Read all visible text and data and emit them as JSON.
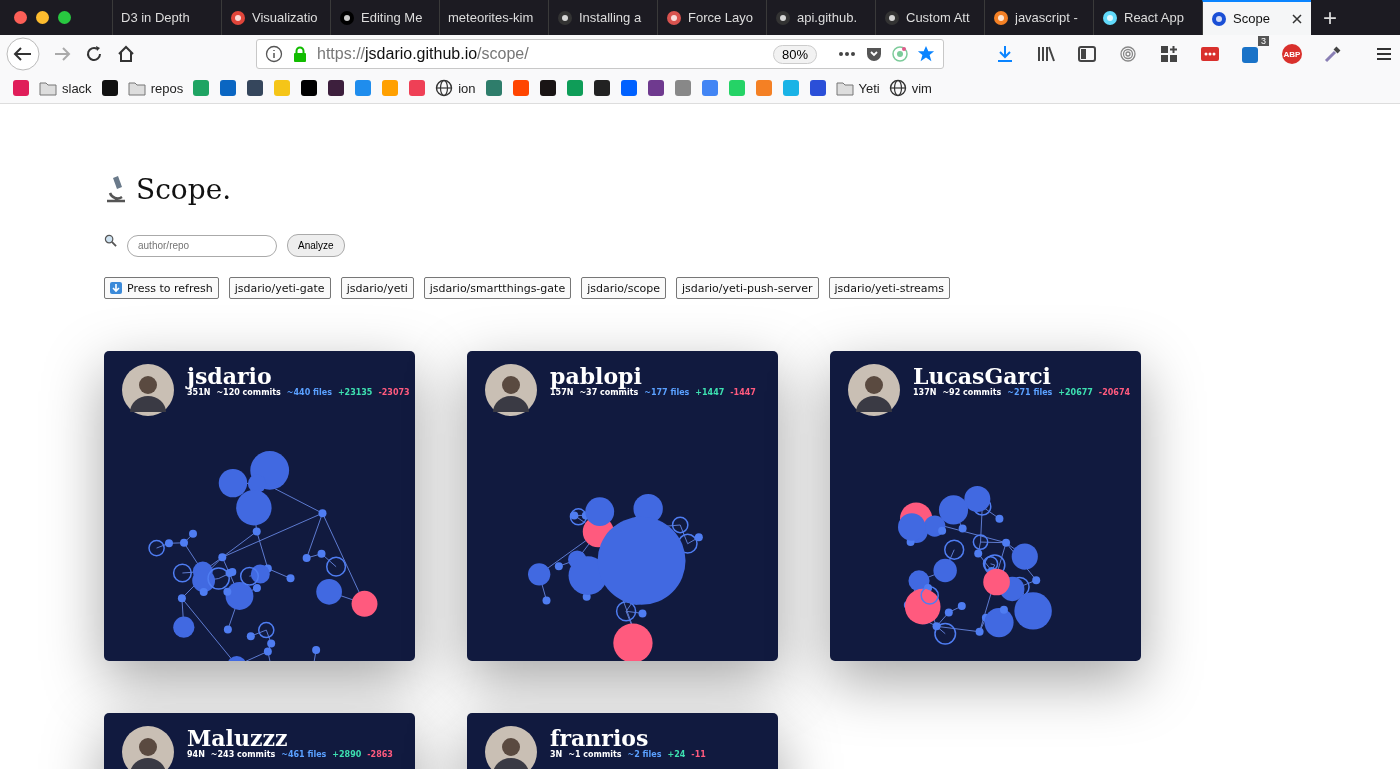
{
  "tabs": [
    {
      "title": "D3 in Depth",
      "kind": "plain",
      "selected": false
    },
    {
      "title": "Visualizatio",
      "kind": "target",
      "selected": false
    },
    {
      "title": "Editing Me",
      "kind": "medium",
      "selected": false
    },
    {
      "title": "meteorites-kim",
      "kind": "plain",
      "selected": false
    },
    {
      "title": "Installing a",
      "kind": "github",
      "selected": false
    },
    {
      "title": "Force Layo",
      "kind": "cube",
      "selected": false
    },
    {
      "title": "api.github.",
      "kind": "github",
      "selected": false
    },
    {
      "title": "Custom Att",
      "kind": "github",
      "selected": false
    },
    {
      "title": "javascript -",
      "kind": "stack",
      "selected": false
    },
    {
      "title": "React App",
      "kind": "react",
      "selected": false
    },
    {
      "title": "Scope",
      "kind": "orb",
      "selected": true
    }
  ],
  "new_tab": "+",
  "address": {
    "scheme": "https://",
    "host": "jsdario.github.io",
    "path": "/scope/",
    "zoom": "80%"
  },
  "toolbar_badges": {
    "sync_count": "3",
    "adblock": "ABP"
  },
  "bookmarks": [
    {
      "kind": "tile",
      "color": "#e01e5a"
    },
    {
      "kind": "folder",
      "label": "slack"
    },
    {
      "kind": "tile",
      "color": "#111111"
    },
    {
      "kind": "folder",
      "label": "repos"
    },
    {
      "kind": "tile",
      "color": "#1fa463"
    },
    {
      "kind": "tile",
      "color": "#0a66c2"
    },
    {
      "kind": "tile",
      "color": "#35465c"
    },
    {
      "kind": "tile",
      "color": "#f5c518"
    },
    {
      "kind": "tile",
      "color": "#000000"
    },
    {
      "kind": "tile",
      "color": "#3d1f3d"
    },
    {
      "kind": "tile",
      "color": "#1f8ded"
    },
    {
      "kind": "tile",
      "color": "#ffa000"
    },
    {
      "kind": "tile",
      "color": "#ef4056"
    },
    {
      "kind": "globe",
      "label": "ion"
    },
    {
      "kind": "tile",
      "color": "#2e7d6b"
    },
    {
      "kind": "tile",
      "color": "#ff4500"
    },
    {
      "kind": "tile",
      "color": "#191414"
    },
    {
      "kind": "tile",
      "color": "#0f9d58"
    },
    {
      "kind": "tile",
      "color": "#222222"
    },
    {
      "kind": "tile",
      "color": "#0061ff"
    },
    {
      "kind": "tile",
      "color": "#6f3a8f"
    },
    {
      "kind": "tile",
      "color": "#888888"
    },
    {
      "kind": "tile",
      "color": "#4285f4"
    },
    {
      "kind": "tile",
      "color": "#25d366"
    },
    {
      "kind": "tile",
      "color": "#f48024"
    },
    {
      "kind": "tile",
      "color": "#1ab3e6"
    },
    {
      "kind": "tile",
      "color": "#2b4fd8"
    },
    {
      "kind": "folder",
      "label": "Yeti"
    },
    {
      "kind": "globe",
      "label": "vim"
    }
  ],
  "page": {
    "title": "Scope.",
    "search": {
      "placeholder": "author/repo"
    },
    "analyze_button": "Analyze"
  },
  "chips": [
    {
      "label": "Press to refresh",
      "kind": "refresh"
    },
    {
      "label": "jsdario/yeti-gate",
      "kind": "repo"
    },
    {
      "label": "jsdario/yeti",
      "kind": "repo"
    },
    {
      "label": "jsdario/smartthings-gate",
      "kind": "repo"
    },
    {
      "label": "jsdario/scope",
      "kind": "repo"
    },
    {
      "label": "jsdario/yeti-push-server",
      "kind": "repo"
    },
    {
      "label": "jsdario/yeti-streams",
      "kind": "repo"
    }
  ],
  "cards": [
    {
      "name": "jsdario",
      "nodes": "351N",
      "commits": "~120 commits",
      "files": "~440 files",
      "additions": "+23135",
      "deletions": "-23073"
    },
    {
      "name": "pablopi",
      "nodes": "157N",
      "commits": "~37 commits",
      "files": "~177 files",
      "additions": "+1447",
      "deletions": "-1447"
    },
    {
      "name": "LucasGarci",
      "nodes": "137N",
      "commits": "~92 commits",
      "files": "~271 files",
      "additions": "+20677",
      "deletions": "-20674"
    },
    {
      "name": "Maluzzz",
      "nodes": "94N",
      "commits": "~243 commits",
      "files": "~461 files",
      "additions": "+2890",
      "deletions": "-2863"
    },
    {
      "name": "franrios",
      "nodes": "3N",
      "commits": "~1 commits",
      "files": "~2 files",
      "additions": "+24",
      "deletions": "-11"
    }
  ]
}
